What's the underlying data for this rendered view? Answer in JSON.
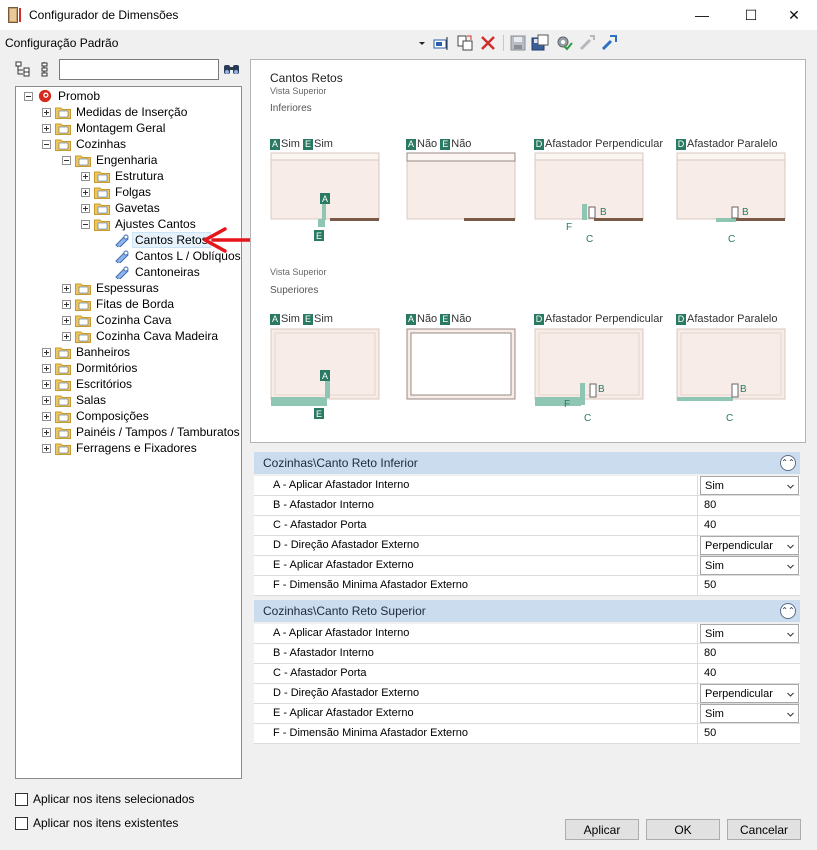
{
  "window": {
    "title": "Configurador de Dimensões"
  },
  "toolbar": {
    "config_label": "Configuração Padrão"
  },
  "tree": {
    "root": "Promob",
    "items": {
      "medidas": "Medidas de Inserção",
      "montagem": "Montagem Geral",
      "cozinhas": "Cozinhas",
      "engenharia": "Engenharia",
      "estrutura": "Estrutura",
      "folgas": "Folgas",
      "gavetas": "Gavetas",
      "ajustes": "Ajustes Cantos",
      "cantos_retos": "Cantos Retos",
      "cantos_l": "Cantos L / Oblíquos",
      "cantoneiras": "Cantoneiras",
      "espessuras": "Espessuras",
      "fitas": "Fitas de Borda",
      "cozinha_cava": "Cozinha Cava",
      "cozinha_cava_madeira": "Cozinha Cava Madeira",
      "banheiros": "Banheiros",
      "dormitorios": "Dormitórios",
      "escritorios": "Escritórios",
      "salas": "Salas",
      "composicoes": "Composições",
      "paineis": "Painéis / Tampos / Tamburatos",
      "ferragens": "Ferragens e Fixadores"
    }
  },
  "options": {
    "selected_items": "Aplicar nos itens selecionados",
    "existing_items": "Aplicar nos itens existentes"
  },
  "preview": {
    "title": "Cantos Retos",
    "vista": "Vista Superior",
    "inferiores": "Inferiores",
    "superiores": "Superiores",
    "headers": {
      "sim": "Sim",
      "nao": "Não",
      "perp": "Afastador Perpendicular",
      "par": "Afastador Paralelo"
    },
    "letters": {
      "a": "A",
      "b": "B",
      "c": "C",
      "d": "D",
      "e": "E",
      "f": "F"
    }
  },
  "sections": {
    "inferior": {
      "title": "Cozinhas\\Canto Reto Inferior",
      "rows": [
        {
          "name": "A - Aplicar Afastador Interno",
          "value": "Sim"
        },
        {
          "name": "B - Afastador Interno",
          "value": "80"
        },
        {
          "name": "C - Afastador Porta",
          "value": "40"
        },
        {
          "name": "D - Direção Afastador Externo",
          "value": "Perpendicular"
        },
        {
          "name": "E - Aplicar Afastador Externo",
          "value": "Sim"
        },
        {
          "name": "F - Dimensão Minima Afastador Externo",
          "value": "50"
        }
      ]
    },
    "superior": {
      "title": "Cozinhas\\Canto Reto Superior",
      "rows": [
        {
          "name": "A - Aplicar Afastador Interno",
          "value": "Sim"
        },
        {
          "name": "B - Afastador Interno",
          "value": "80"
        },
        {
          "name": "C - Afastador Porta",
          "value": "40"
        },
        {
          "name": "D - Direção Afastador Externo",
          "value": "Perpendicular"
        },
        {
          "name": "E - Aplicar Afastador Externo",
          "value": "Sim"
        },
        {
          "name": "F - Dimensão Minima Afastador Externo",
          "value": "50"
        }
      ]
    }
  },
  "buttons": {
    "apply": "Aplicar",
    "ok": "OK",
    "cancel": "Cancelar"
  }
}
